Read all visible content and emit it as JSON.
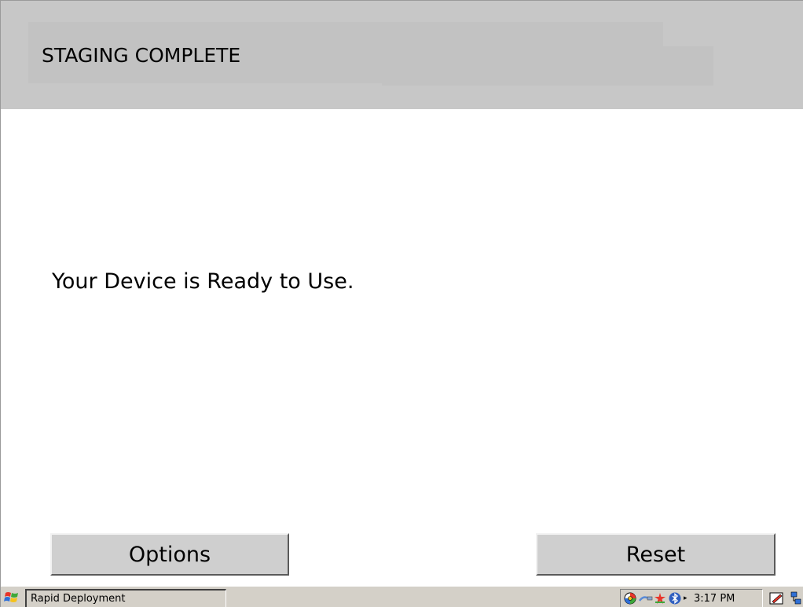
{
  "header": {
    "title": "STAGING COMPLETE"
  },
  "main": {
    "message": "Your Device is Ready to Use."
  },
  "buttons": {
    "options_label": "Options",
    "reset_label": "Reset"
  },
  "taskbar": {
    "start_icon": "windows-flag-icon",
    "task_button_label": "Rapid Deployment",
    "tray_icons": [
      "colorful-circle-icon",
      "network-cable-icon",
      "red-star-icon",
      "bluetooth-icon"
    ],
    "tray_arrow": "▸",
    "clock": "3:17 PM",
    "right_icons": [
      "edit-pen-icon",
      "network-connection-icon"
    ]
  },
  "colors": {
    "header_bg": "#c7c7c7",
    "button_bg": "#cfcfcf",
    "taskbar_bg": "#d4d0c8"
  }
}
